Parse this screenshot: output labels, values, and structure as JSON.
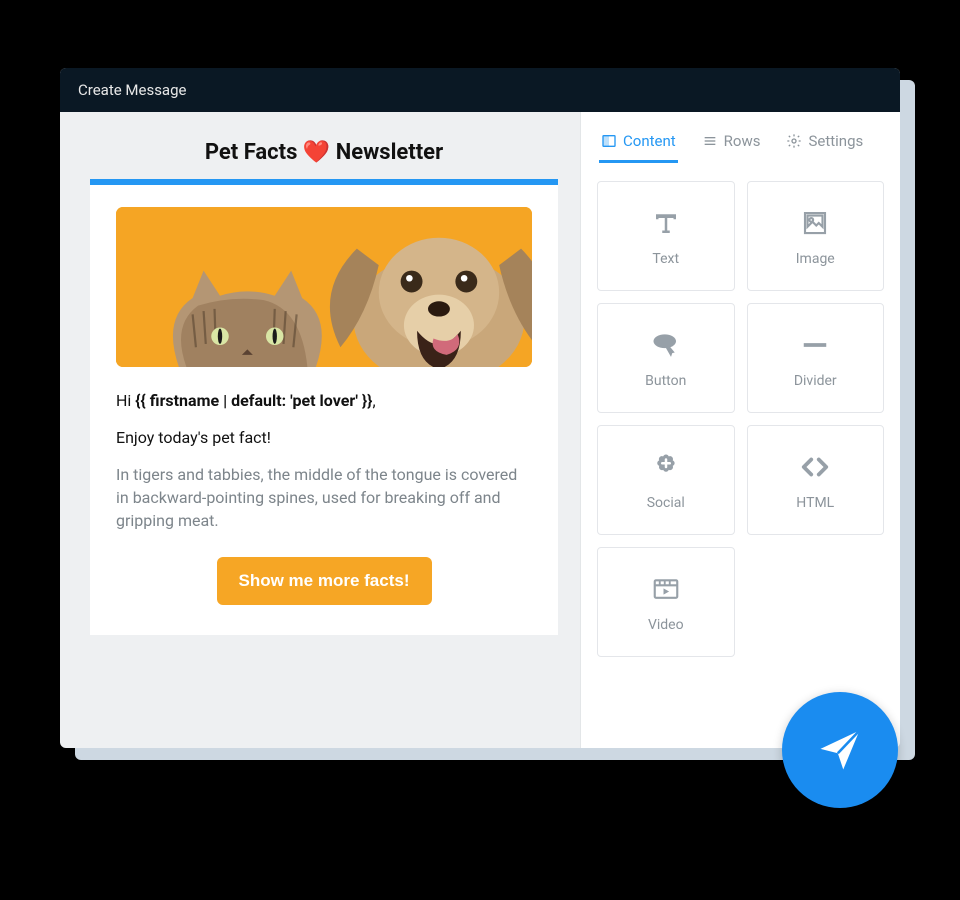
{
  "window": {
    "title": "Create Message"
  },
  "preview": {
    "title_prefix": "Pet Facts",
    "title_emoji": "❤️",
    "title_suffix": "Newsletter",
    "greeting_hi": "Hi ",
    "greeting_var": "{{ firstname | default: 'pet lover' }}",
    "greeting_comma": ",",
    "intro": "Enjoy today's pet fact!",
    "fact": "In tigers and tabbies, the middle of the tongue is covered in backward-pointing spines, used for breaking off and gripping meat.",
    "cta": "Show me more facts!"
  },
  "tabs": {
    "content": "Content",
    "rows": "Rows",
    "settings": "Settings"
  },
  "blocks": {
    "text": "Text",
    "image": "Image",
    "button": "Button",
    "divider": "Divider",
    "social": "Social",
    "html": "HTML",
    "video": "Video"
  },
  "colors": {
    "accent": "#2497f3",
    "cta": "#f6a625",
    "fab": "#1a8cf0"
  }
}
